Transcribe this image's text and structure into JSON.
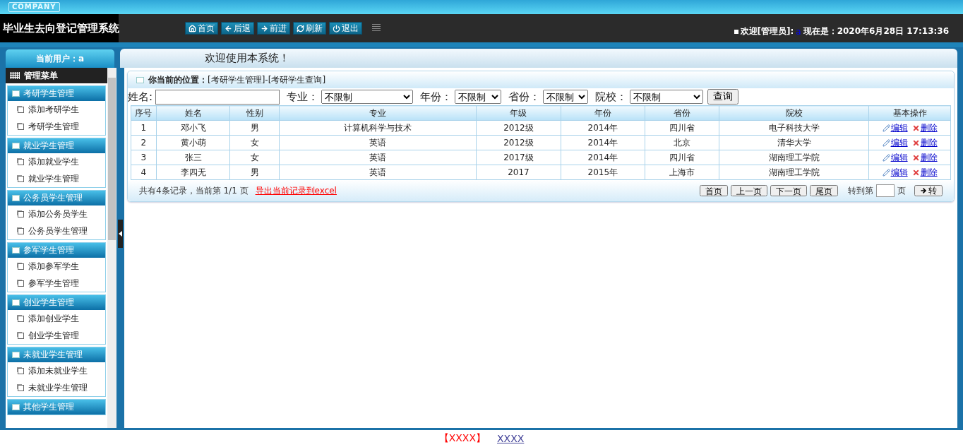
{
  "header": {
    "logo": "COMPANY",
    "title": "毕业生去向登记管理系统",
    "nav": [
      "首页",
      "后退",
      "前进",
      "刷新",
      "退出"
    ],
    "welcome": {
      "prefix": "欢迎[管理员]:",
      "user": "a",
      "time": "现在是：2020年6月28日 17:13:36"
    }
  },
  "sidebar": {
    "user": "当前用户：a",
    "menu_title": "管理菜单",
    "groups": [
      {
        "title": "考研学生管理",
        "items": [
          "添加考研学生",
          "考研学生管理"
        ]
      },
      {
        "title": "就业学生管理",
        "items": [
          "添加就业学生",
          "就业学生管理"
        ]
      },
      {
        "title": "公务员学生管理",
        "items": [
          "添加公务员学生",
          "公务员学生管理"
        ]
      },
      {
        "title": "参军学生管理",
        "items": [
          "添加参军学生",
          "参军学生管理"
        ]
      },
      {
        "title": "创业学生管理",
        "items": [
          "添加创业学生",
          "创业学生管理"
        ]
      },
      {
        "title": "未就业学生管理",
        "items": [
          "添加未就业学生",
          "未就业学生管理"
        ]
      },
      {
        "title": "其他学生管理"
      }
    ]
  },
  "welcome_bar": "欢迎使用本系统！",
  "breadcrumb": {
    "label": "你当前的位置：",
    "path": "[考研学生管理]-[考研学生查询]"
  },
  "filters": [
    {
      "kind": "text",
      "label": "姓名:"
    },
    {
      "kind": "select",
      "label": "专业：",
      "value": "不限制"
    },
    {
      "kind": "select",
      "label": "年份：",
      "value": "不限制"
    },
    {
      "kind": "select",
      "label": "省份：",
      "value": "不限制"
    },
    {
      "kind": "select",
      "label": "院校：",
      "value": "不限制"
    }
  ],
  "search_button": "查询",
  "table": {
    "columns": [
      "序号",
      "姓名",
      "性别",
      "专业",
      "年级",
      "年份",
      "省份",
      "院校",
      "基本操作"
    ],
    "rows": [
      {
        "cells": [
          "1",
          "邓小飞",
          "男",
          "计算机科学与技术",
          "2012级",
          "2014年",
          "四川省",
          "电子科技大学"
        ],
        "actions": [
          "编辑",
          "删除"
        ]
      },
      {
        "cells": [
          "2",
          "黄小萌",
          "女",
          "英语",
          "2012级",
          "2014年",
          "北京",
          "清华大学"
        ],
        "actions": [
          "编辑",
          "删除"
        ]
      },
      {
        "cells": [
          "3",
          "张三",
          "女",
          "英语",
          "2017级",
          "2014年",
          "四川省",
          "湖南理工学院"
        ],
        "actions": [
          "编辑",
          "删除"
        ]
      },
      {
        "cells": [
          "4",
          "李四无",
          "男",
          "英语",
          "2017",
          "2015年",
          "上海市",
          "湖南理工学院"
        ],
        "actions": [
          "编辑",
          "删除"
        ]
      }
    ]
  },
  "pager": {
    "summary": "共有4条记录，当前第 1/1 页",
    "export": "导出当前记录到excel",
    "buttons": [
      "首页",
      "上一页",
      "下一页",
      "尾页"
    ],
    "goto_label": "转到第",
    "page_unit": "页",
    "go_button": "转"
  },
  "footer": {
    "bracket_text": "【XXXX】",
    "link": "XXXX"
  }
}
